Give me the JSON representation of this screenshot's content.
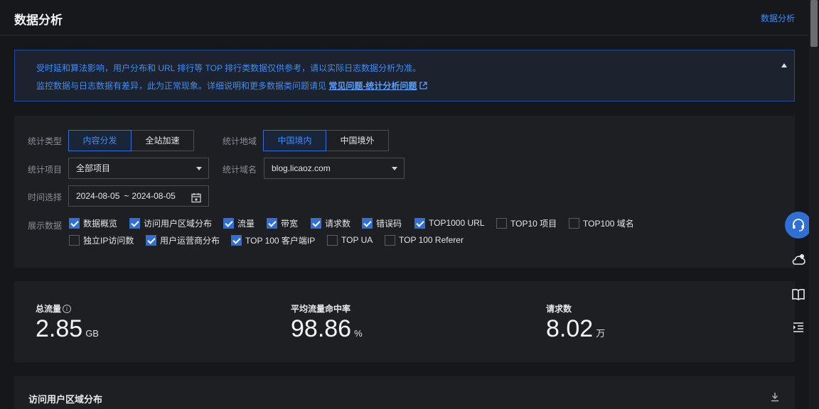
{
  "header": {
    "title": "数据分析",
    "link": "数据分析"
  },
  "notice": {
    "line1": "受时延和算法影响，用户分布和 URL 排行等 TOP 排行类数据仅供参考，请以实际日志数据分析为准。",
    "line2_prefix": "监控数据与日志数据有差异，此为正常现象。详细说明和更多数据类问题请见",
    "line2_link": "常见问题-统计分析问题"
  },
  "filters": {
    "stat_type_label": "统计类型",
    "stat_type_options": [
      "内容分发",
      "全站加速"
    ],
    "region_label": "统计地域",
    "region_options": [
      "中国境内",
      "中国境外"
    ],
    "project_label": "统计项目",
    "project_value": "全部项目",
    "domain_label": "统计域名",
    "domain_value": "blog.licaoz.com",
    "time_label": "时间选择",
    "date_start": "2024-08-05",
    "date_sep": "~",
    "date_end": "2024-08-05",
    "display_label": "展示数据",
    "display_items": [
      {
        "label": "数据概览",
        "checked": true
      },
      {
        "label": "访问用户区域分布",
        "checked": true
      },
      {
        "label": "流量",
        "checked": true
      },
      {
        "label": "带宽",
        "checked": true
      },
      {
        "label": "请求数",
        "checked": true
      },
      {
        "label": "错误码",
        "checked": true
      },
      {
        "label": "TOP1000 URL",
        "checked": true
      },
      {
        "label": "TOP10 项目",
        "checked": false
      },
      {
        "label": "TOP100 域名",
        "checked": false
      },
      {
        "label": "独立IP访问数",
        "checked": false
      },
      {
        "label": "用户运营商分布",
        "checked": true
      },
      {
        "label": "TOP 100 客户端IP",
        "checked": true
      },
      {
        "label": "TOP UA",
        "checked": false
      },
      {
        "label": "TOP 100 Referer",
        "checked": false
      }
    ]
  },
  "stats": [
    {
      "label": "总流量",
      "value": "2.85",
      "unit": "GB"
    },
    {
      "label": "平均流量命中率",
      "value": "98.86",
      "unit": "%"
    },
    {
      "label": "请求数",
      "value": "8.02",
      "unit": "万"
    }
  ],
  "region_section": {
    "title": "访问用户区域分布"
  },
  "float_buttons": [
    "headset-icon",
    "cloud-icon",
    "book-icon",
    "list-icon"
  ],
  "colors": {
    "accent": "#2f6fd6",
    "link": "#3d8cf5",
    "background": "#16171a",
    "panel": "#1e1f23"
  }
}
